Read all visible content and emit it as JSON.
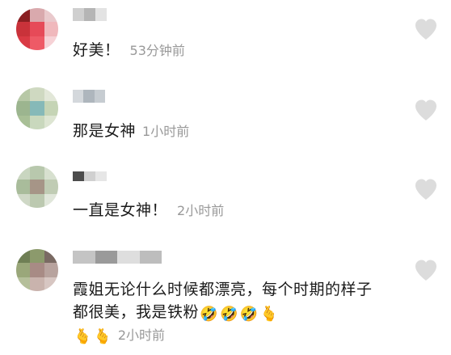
{
  "comments": [
    {
      "text": "好美！",
      "time": "53分钟前",
      "avatar_colors": [
        "#8a1f22",
        "#d9a9ad",
        "#e9c9cc",
        "#c9323a",
        "#e64a58",
        "#f0b8bc",
        "#d93a44",
        "#ee5a66",
        "#f6d2d6"
      ],
      "name_colors": [
        "#cfcfcf",
        "#b5b5b5",
        "#e3e3e3"
      ]
    },
    {
      "text": "那是女神",
      "time": "1小时前",
      "avatar_colors": [
        "#b7c8a6",
        "#cfd9c1",
        "#e2e7d8",
        "#9cb58f",
        "#86b9b8",
        "#c5d4b5",
        "#a8bf96",
        "#c9d8bd",
        "#dde5d2"
      ],
      "name_colors": [
        "#d4d8dc",
        "#aeb6bd",
        "#c6ccd1"
      ]
    },
    {
      "text": "一直是女神！",
      "time": "2小时前",
      "avatar_colors": [
        "#c9d6c0",
        "#b8c8ad",
        "#d7e0cf",
        "#a9bc9b",
        "#a69587",
        "#c0ccb4",
        "#cfd8c6",
        "#bcc9b0",
        "#e0e6da"
      ],
      "name_colors": [
        "#4c4c4c",
        "#d0d0d0",
        "#e6e6e6"
      ]
    },
    {
      "text": "霞姐无论什么时候都漂亮，每个时期的样子都很美，我是铁粉",
      "time": "2小时前",
      "emojis_line1": [
        "🤣",
        "🤣",
        "🤣",
        "🫰"
      ],
      "emojis_line2": [
        "🫰",
        "🫰"
      ],
      "avatar_colors": [
        "#6f7f55",
        "#8c9a6c",
        "#7a6a63",
        "#9aa77a",
        "#a88b85",
        "#b8a39e",
        "#b5bf9a",
        "#c9b3ad",
        "#d7c6c2"
      ],
      "name_colors": [
        "#c4c4c4",
        "#9a9a9a",
        "#dedede",
        "#bdbdbd"
      ]
    }
  ],
  "icons": {
    "like": "heart-icon"
  },
  "colors": {
    "time_text": "#999999",
    "like_icon": "#dcdcdc"
  }
}
